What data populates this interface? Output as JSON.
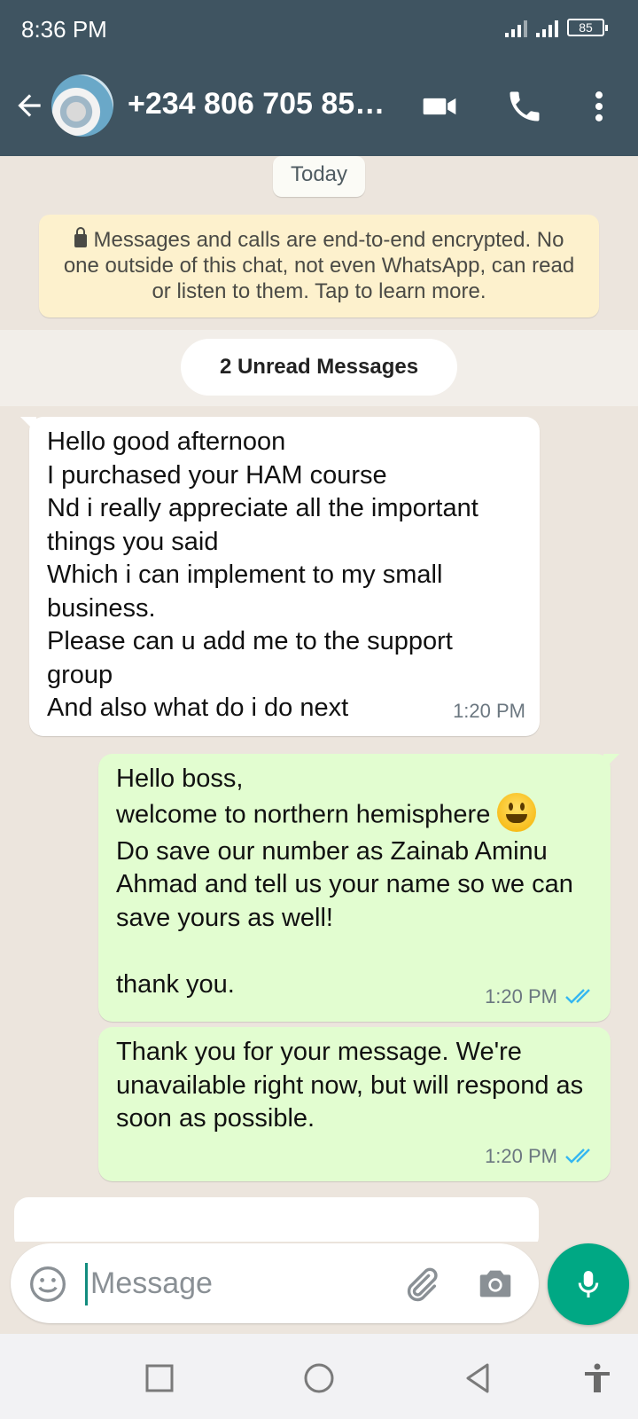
{
  "status_bar": {
    "time": "8:36 PM",
    "battery": "85"
  },
  "header": {
    "contact": "+234 806 705 85…"
  },
  "chat": {
    "date_chip": "Today",
    "encryption_notice": "Messages and calls are end-to-end encrypted. No one outside of this chat, not even WhatsApp, can read or listen to them. Tap to learn more.",
    "unread_label": "2 Unread Messages",
    "messages": [
      {
        "direction": "incoming",
        "text": "Hello good afternoon\nI purchased your HAM course\nNd i really appreciate all the important things you said\nWhich i can implement to my small business.\nPlease can u add me to the support group\nAnd also what do i do next",
        "time": "1:20 PM"
      },
      {
        "direction": "outgoing",
        "text_line1": "Hello boss,",
        "text_line2": "welcome to northern hemisphere ",
        "emoji": "grinning-face",
        "text_rest": "Do save our number as Zainab Aminu Ahmad and tell us your name so we can save yours as well!\n\nthank you.",
        "time": "1:20 PM",
        "status": "read"
      },
      {
        "direction": "outgoing",
        "text": "Thank you for your message. We're unavailable right now, but will respond as soon as possible.",
        "time": "1:20 PM",
        "status": "read"
      }
    ]
  },
  "composer": {
    "placeholder": "Message"
  },
  "colors": {
    "header": "#3f5461",
    "outgoing_bubble": "#e2fdd0",
    "accent": "#00a884",
    "read_tick": "#34b7f1",
    "chat_background": "#ece5dd"
  }
}
